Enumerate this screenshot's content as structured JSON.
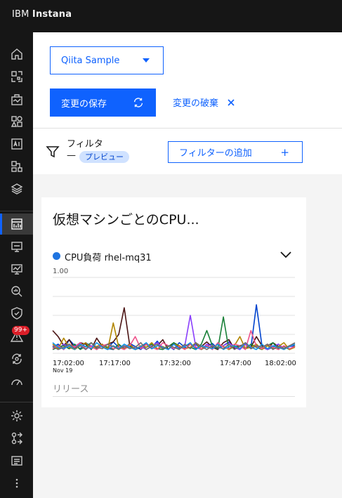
{
  "header": {
    "brand_prefix": "IBM",
    "brand_name": "Instana"
  },
  "sidenav": {
    "items": [
      {
        "icon": "home-icon"
      },
      {
        "icon": "websites-icon"
      },
      {
        "icon": "applications-icon"
      },
      {
        "icon": "platforms-icon"
      },
      {
        "icon": "ai-icon"
      },
      {
        "icon": "infrastructure-icon"
      },
      {
        "icon": "stack-icon"
      },
      {
        "icon": "dashboards-icon",
        "active": true
      },
      {
        "icon": "synthetic-monitor-icon"
      },
      {
        "icon": "monitoring-icon"
      },
      {
        "icon": "analytics-icon"
      },
      {
        "icon": "security-icon"
      },
      {
        "icon": "alerts-icon",
        "badge": "99+"
      },
      {
        "icon": "automation-icon"
      },
      {
        "icon": "performance-icon"
      },
      {
        "icon": "settings-icon"
      },
      {
        "icon": "integrations-icon"
      },
      {
        "icon": "news-icon"
      },
      {
        "icon": "more-icon"
      }
    ]
  },
  "toolbar": {
    "dashboard_select": "Qiita Sample",
    "save_label": "変更の保存",
    "discard_label": "変更の破棄",
    "filter_label": "フィルタ",
    "filter_value": "—",
    "preview_tag": "プレビュー",
    "add_filter_label": "フィルターの追加",
    "add_filter_plus": "+"
  },
  "widget": {
    "title": "仮想マシンごとのCPU...",
    "legend_label": "CPU負荷 rhel-mq31",
    "legend_color": "#1f74e0",
    "y_top_label": "1.00",
    "x_ticks": [
      "17:02:00",
      "17:17:00",
      "17:32:00",
      "17:47:00",
      "18:02:00"
    ],
    "x_date": "Nov 19",
    "release_label": "リリース"
  },
  "chart_data": {
    "type": "line",
    "ylim": [
      0,
      1
    ],
    "x_ticks": [
      "17:02:00",
      "17:17:00",
      "17:32:00",
      "17:47:00",
      "18:02:00"
    ],
    "series": [
      {
        "name": "CPU負荷 rhel-mq31",
        "color": "#0043ce",
        "values": [
          0.08,
          0.12,
          0.05,
          0.18,
          0.1,
          0.06,
          0.14,
          0.09,
          0.05,
          0.11,
          0.07,
          0.15,
          0.08,
          0.06,
          0.13,
          0.09,
          0.05,
          0.12,
          0.08,
          0.16,
          0.06,
          0.1,
          0.05,
          0.14,
          0.08,
          0.07,
          0.12,
          0.05,
          0.09,
          0.13,
          0.06,
          0.1,
          0.15,
          0.08,
          0.05,
          0.12,
          0.07,
          0.64,
          0.1,
          0.05,
          0.08,
          0.12,
          0.06,
          0.09,
          0.1
        ]
      },
      {
        "color": "#4b1414",
        "values": [
          0.3,
          0.22,
          0.1,
          0.18,
          0.06,
          0.14,
          0.12,
          0.05,
          0.2,
          0.09,
          0.12,
          0.15,
          0.25,
          0.6,
          0.1,
          0.05,
          0.08,
          0.12,
          0.06,
          0.1,
          0.18,
          0.05,
          0.14,
          0.07,
          0.1,
          0.12,
          0.06,
          0.09,
          0.15,
          0.08,
          0.05,
          0.14,
          0.18,
          0.06,
          0.1,
          0.12,
          0.08,
          0.22,
          0.1,
          0.05,
          0.14,
          0.09,
          0.06,
          0.1,
          0.12
        ]
      },
      {
        "color": "#8a3ffc",
        "values": [
          0.1,
          0.05,
          0.12,
          0.06,
          0.09,
          0.14,
          0.05,
          0.1,
          0.08,
          0.12,
          0.06,
          0.05,
          0.1,
          0.08,
          0.12,
          0.06,
          0.09,
          0.05,
          0.1,
          0.14,
          0.08,
          0.05,
          0.12,
          0.06,
          0.1,
          0.5,
          0.08,
          0.05,
          0.12,
          0.09,
          0.06,
          0.1,
          0.14,
          0.08,
          0.05,
          0.12,
          0.06,
          0.1,
          0.08,
          0.05,
          0.09,
          0.12,
          0.06,
          0.1,
          0.08
        ]
      },
      {
        "color": "#198038",
        "values": [
          0.05,
          0.08,
          0.1,
          0.06,
          0.12,
          0.05,
          0.09,
          0.14,
          0.06,
          0.1,
          0.08,
          0.05,
          0.12,
          0.06,
          0.09,
          0.05,
          0.1,
          0.08,
          0.12,
          0.06,
          0.05,
          0.09,
          0.14,
          0.1,
          0.06,
          0.08,
          0.05,
          0.12,
          0.3,
          0.1,
          0.06,
          0.48,
          0.05,
          0.09,
          0.1,
          0.06,
          0.12,
          0.08,
          0.05,
          0.1,
          0.14,
          0.06,
          0.09,
          0.05,
          0.1
        ]
      },
      {
        "color": "#b28600",
        "values": [
          0.12,
          0.06,
          0.2,
          0.08,
          0.05,
          0.1,
          0.14,
          0.06,
          0.09,
          0.12,
          0.05,
          0.4,
          0.08,
          0.06,
          0.12,
          0.05,
          0.1,
          0.08,
          0.14,
          0.06,
          0.09,
          0.05,
          0.12,
          0.1,
          0.06,
          0.08,
          0.14,
          0.05,
          0.1,
          0.06,
          0.12,
          0.09,
          0.05,
          0.1,
          0.22,
          0.06,
          0.08,
          0.12,
          0.05,
          0.1,
          0.06,
          0.09,
          0.14,
          0.05,
          0.08
        ]
      },
      {
        "color": "#ee538b",
        "values": [
          0.06,
          0.1,
          0.05,
          0.12,
          0.08,
          0.14,
          0.06,
          0.09,
          0.05,
          0.1,
          0.12,
          0.06,
          0.08,
          0.05,
          0.1,
          0.22,
          0.06,
          0.12,
          0.08,
          0.05,
          0.14,
          0.1,
          0.06,
          0.09,
          0.05,
          0.12,
          0.08,
          0.06,
          0.1,
          0.05,
          0.14,
          0.08,
          0.06,
          0.12,
          0.1,
          0.05,
          0.3,
          0.09,
          0.06,
          0.12,
          0.08,
          0.05,
          0.1,
          0.06,
          0.09
        ]
      },
      {
        "color": "#1192e8",
        "values": [
          0.14,
          0.08,
          0.06,
          0.1,
          0.05,
          0.12,
          0.09,
          0.06,
          0.14,
          0.08,
          0.05,
          0.1,
          0.06,
          0.12,
          0.08,
          0.05,
          0.09,
          0.14,
          0.06,
          0.1,
          0.08,
          0.05,
          0.12,
          0.06,
          0.09,
          0.14,
          0.05,
          0.1,
          0.08,
          0.06,
          0.12,
          0.05,
          0.09,
          0.1,
          0.06,
          0.14,
          0.08,
          0.05,
          0.12,
          0.06,
          0.1,
          0.08,
          0.05,
          0.09,
          0.12
        ]
      },
      {
        "color": "#6f6f6f",
        "values": [
          0.09,
          0.05,
          0.08,
          0.12,
          0.06,
          0.1,
          0.05,
          0.14,
          0.08,
          0.06,
          0.12,
          0.09,
          0.05,
          0.1,
          0.06,
          0.08,
          0.14,
          0.05,
          0.09,
          0.12,
          0.06,
          0.1,
          0.08,
          0.05,
          0.12,
          0.06,
          0.14,
          0.09,
          0.05,
          0.1,
          0.08,
          0.06,
          0.12,
          0.05,
          0.09,
          0.14,
          0.06,
          0.1,
          0.08,
          0.12,
          0.05,
          0.09,
          0.06,
          0.1,
          0.14
        ]
      }
    ]
  }
}
